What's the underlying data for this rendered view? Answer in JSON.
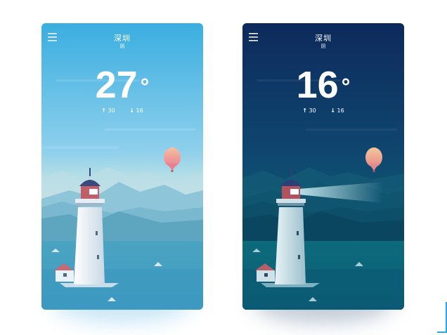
{
  "cards": {
    "day": {
      "city": "深圳",
      "condition": "阴",
      "temperature": "27",
      "degree_symbol": "°",
      "high": "30",
      "low": "16",
      "high_arrow": "↑",
      "low_arrow": "↓"
    },
    "night": {
      "city": "深圳",
      "condition": "阴",
      "temperature": "16",
      "degree_symbol": "°",
      "high": "30",
      "low": "16",
      "high_arrow": "↑",
      "low_arrow": "↓"
    }
  },
  "icons": {
    "menu": "hamburger-menu-icon",
    "balloon": "hot-air-balloon-icon",
    "lighthouse": "lighthouse-icon",
    "house": "house-icon"
  },
  "colors": {
    "day_sky_top": "#3aaee0",
    "day_sky_bottom": "#f3ecd0",
    "night_sky_top": "#0d2a5c",
    "night_sky_bottom": "#0d5a6e",
    "accent": "#2aa6e0"
  }
}
